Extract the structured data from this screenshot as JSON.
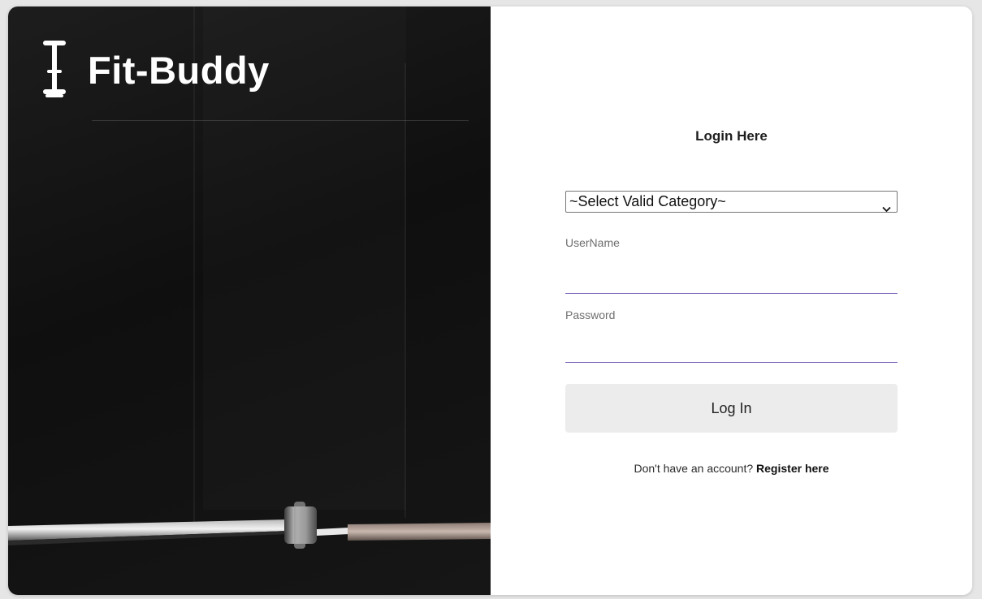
{
  "brand": {
    "name": "Fit-Buddy",
    "logo_icon": "dumbbell-icon"
  },
  "login": {
    "title": "Login Here",
    "category_select": {
      "selected": "~Select Valid Category~"
    },
    "username": {
      "label": "UserName",
      "value": ""
    },
    "password": {
      "label": "Password",
      "value": ""
    },
    "submit_label": "Log In",
    "register_prompt": "Don't have an account?",
    "register_link": "Register here"
  },
  "colors": {
    "left_panel": "#141414",
    "input_underline": "#7a62b8",
    "button_background": "#ececec"
  }
}
